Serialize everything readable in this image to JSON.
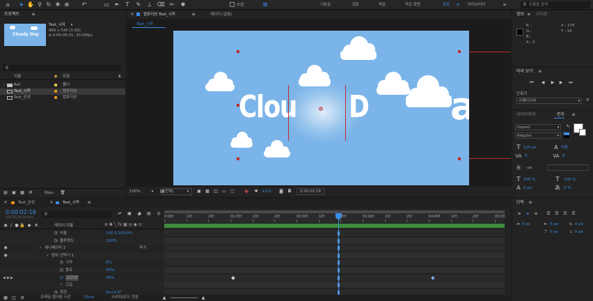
{
  "colors": {
    "accent": "#3b8de6",
    "sky": "#7bb4e8",
    "keyframe": "#d0d0d0",
    "handle": "#c02a2a",
    "timeline_green": "#3e8d3e"
  },
  "toolbar": {
    "workspaces": [
      "기본값",
      "검토",
      "학습",
      "작은 화면",
      "표준",
      "라이브러리"
    ],
    "active_workspace": "표준",
    "search_placeholder": "도움말 검색",
    "snap_label": "스냅"
  },
  "project": {
    "title": "프로젝트",
    "comp_name": "Text_시작",
    "comp_info1": "960 x 540 (1.00)",
    "comp_info2": "Δ 0:00:05:01, 30.00fps",
    "thumb_text": "Cloudy Day",
    "search_placeholder": "",
    "col_name": "이름",
    "col_type": "유형",
    "items": [
      {
        "name": "Ref",
        "type": "폴더",
        "color": "#e0c24a",
        "icon": "folder-icon"
      },
      {
        "name": "Text_시작",
        "type": "컴포지션",
        "color": "#e58f1f",
        "icon": "composition-icon"
      },
      {
        "name": "Text_완성",
        "type": "컴포지션",
        "color": "#e58f1f",
        "icon": "composition-icon"
      }
    ],
    "bpc": "8bpc"
  },
  "comp_panel": {
    "tab_label": "컴포지션 Text_시작",
    "layer_tab": "레이어 (없음)",
    "breadcrumb": "Text_시작",
    "zoom": "100%",
    "resolution": "(전체)",
    "exposure": "+0.0",
    "timecode": "0:00:02:18",
    "canvas_text_left": "Clou",
    "canvas_text_right": "D",
    "canvas_text_far": "a"
  },
  "info": {
    "tab": "정보",
    "tab2": "오디오",
    "r": "R :",
    "g": "G :",
    "b": "B :",
    "a": "A :  0",
    "x": "X : 275",
    "y": "Y : 15"
  },
  "preview": {
    "tab": "미리 보기"
  },
  "shortcut": {
    "label": "단축키",
    "value": "스페이스바"
  },
  "character": {
    "tab_lib": "라이브러리",
    "tab": "문자",
    "font": "Impact",
    "style": "Regular",
    "size": "120 px",
    "leading": "자동",
    "tracking": "0",
    "kerning": "0",
    "stroke": "- px",
    "vscale": "100 %",
    "hscale": "100 %",
    "baseline": "0 px",
    "tsume": "0 %"
  },
  "paragraph": {
    "tab": "단락",
    "indent1": "0 px",
    "indent2": "0 px",
    "indent3": "0 px",
    "space1": "0 px",
    "space2": "0 px"
  },
  "timeline": {
    "tab_done": "Text_완성",
    "tab_start": "Text_시작",
    "current_time": "0:00:02:18",
    "frame_info": "00078 (30.00 fps)",
    "search_placeholder": "",
    "col_source": "레이어 이름",
    "rulers": [
      "0:00f",
      "10f",
      "20f",
      "01:00f",
      "10f",
      "20f",
      "02:00f",
      "10f",
      "20f",
      "03:00f",
      "10f",
      "20f",
      "04:00f",
      "10f",
      "20f",
      "05:00"
    ],
    "rows": [
      {
        "label": "비율",
        "value": "100.0,100.0%",
        "indent": 86
      },
      {
        "label": "불투명도",
        "value": "100%",
        "indent": 86
      },
      {
        "label": "애니메이터 2",
        "value": "추가:",
        "indent": 64
      },
      {
        "label": "범위 선택기 1",
        "value": "",
        "indent": 74
      },
      {
        "label": "시작",
        "value": "0%",
        "indent": 94
      },
      {
        "label": "종료",
        "value": "30%",
        "indent": 94
      },
      {
        "label": "오프셋",
        "value": "39%",
        "indent": 94
      },
      {
        "label": "고급",
        "value": "",
        "indent": 94
      },
      {
        "label": "회전",
        "value": "0x+0.0°",
        "indent": 86
      }
    ],
    "footer_render": "프레임 렌더링 시간",
    "footer_render_val": "31ms",
    "footer_toggle": "스위치/모드 전환"
  }
}
